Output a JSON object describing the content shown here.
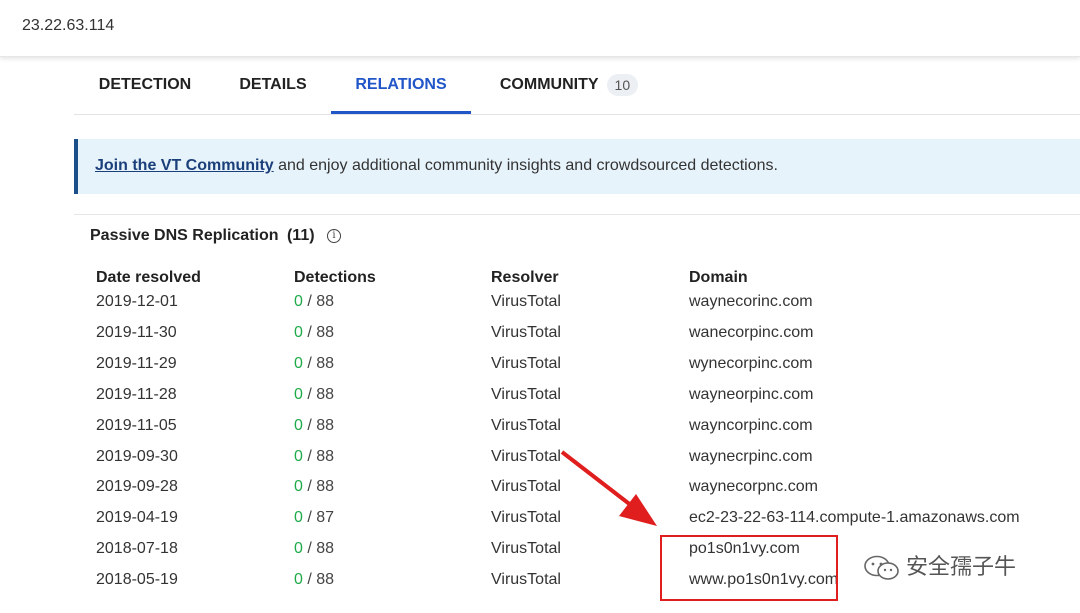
{
  "search": {
    "query": "23.22.63.114"
  },
  "tabs": [
    {
      "label": "DETECTION"
    },
    {
      "label": "DETAILS"
    },
    {
      "label": "RELATIONS"
    },
    {
      "label": "COMMUNITY",
      "badge": "10"
    }
  ],
  "banner": {
    "link_text": "Join the VT Community",
    "text": " and enjoy additional community insights and crowdsourced detections."
  },
  "section": {
    "title": "Passive DNS Replication",
    "count": "(11)"
  },
  "table": {
    "headers": [
      "Date resolved",
      "Detections",
      "Resolver",
      "Domain"
    ],
    "rows": [
      {
        "date": "2019-12-01",
        "det_pos": "0",
        "det_total": " / 88",
        "resolver": "VirusTotal",
        "domain": "waynecorinc.com"
      },
      {
        "date": "2019-11-30",
        "det_pos": "0",
        "det_total": " / 88",
        "resolver": "VirusTotal",
        "domain": "wanecorpinc.com"
      },
      {
        "date": "2019-11-29",
        "det_pos": "0",
        "det_total": " / 88",
        "resolver": "VirusTotal",
        "domain": "wynecorpinc.com"
      },
      {
        "date": "2019-11-28",
        "det_pos": "0",
        "det_total": " / 88",
        "resolver": "VirusTotal",
        "domain": "wayneorpinc.com"
      },
      {
        "date": "2019-11-05",
        "det_pos": "0",
        "det_total": " / 88",
        "resolver": "VirusTotal",
        "domain": "wayncorpinc.com"
      },
      {
        "date": "2019-09-30",
        "det_pos": "0",
        "det_total": " / 88",
        "resolver": "VirusTotal",
        "domain": "waynecrpinc.com"
      },
      {
        "date": "2019-09-28",
        "det_pos": "0",
        "det_total": " / 88",
        "resolver": "VirusTotal",
        "domain": "waynecorpnc.com"
      },
      {
        "date": "2019-04-19",
        "det_pos": "0",
        "det_total": " / 87",
        "resolver": "VirusTotal",
        "domain": "ec2-23-22-63-114.compute-1.amazonaws.com"
      },
      {
        "date": "2018-07-18",
        "det_pos": "0",
        "det_total": " / 88",
        "resolver": "VirusTotal",
        "domain": "po1s0n1vy.com"
      },
      {
        "date": "2018-05-19",
        "det_pos": "0",
        "det_total": " / 88",
        "resolver": "VirusTotal",
        "domain": "www.po1s0n1vy.com"
      }
    ]
  },
  "watermark": {
    "text": "安全孺子牛",
    "icon": "wechat-icon"
  },
  "colors": {
    "accent": "#2056c8",
    "detection_ok": "#1faa49",
    "annotation": "#e01e1e"
  }
}
